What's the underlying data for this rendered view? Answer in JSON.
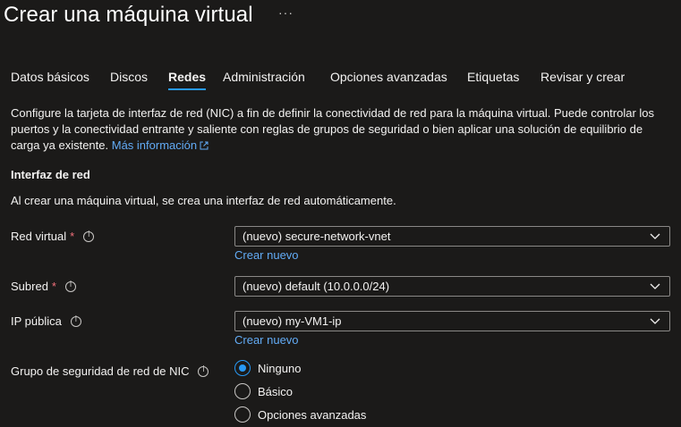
{
  "header": {
    "title": "Crear una máquina virtual",
    "more_label": "···"
  },
  "tabs": [
    {
      "label": "Datos básicos",
      "active": false
    },
    {
      "label": "Discos",
      "active": false
    },
    {
      "label": "Redes",
      "active": true
    },
    {
      "label": "Administración",
      "active": false
    },
    {
      "label": "Opciones avanzadas",
      "active": false
    },
    {
      "label": "Etiquetas",
      "active": false
    },
    {
      "label": "Revisar y crear",
      "active": false
    }
  ],
  "description": {
    "text": "Configure la tarjeta de interfaz de red (NIC) a fin de definir la conectividad de red para la máquina virtual. Puede controlar los puertos y la conectividad entrante y saliente con reglas de grupos de seguridad o bien aplicar una solución de equilibrio de carga ya existente.",
    "link": "Más información"
  },
  "network_interface": {
    "title": "Interfaz de red",
    "description": "Al crear una máquina virtual, se crea una interfaz de red automáticamente."
  },
  "fields": {
    "vnet": {
      "label": "Red virtual",
      "required": "*",
      "value": "(nuevo) secure-network-vnet",
      "create_link": "Crear nuevo"
    },
    "subnet": {
      "label": "Subred",
      "required": "*",
      "value": "(nuevo) default (10.0.0.0/24)"
    },
    "public_ip": {
      "label": "IP pública",
      "value": "(nuevo) my-VM1-ip",
      "create_link": "Crear nuevo"
    },
    "nsg": {
      "label": "Grupo de seguridad de red de NIC",
      "options": [
        "Ninguno",
        "Básico",
        "Opciones avanzadas"
      ],
      "selected": "Ninguno"
    }
  },
  "colors": {
    "background": "#1b1a19",
    "accent": "#2899f5",
    "link": "#62abf5",
    "required": "#f1707b"
  }
}
